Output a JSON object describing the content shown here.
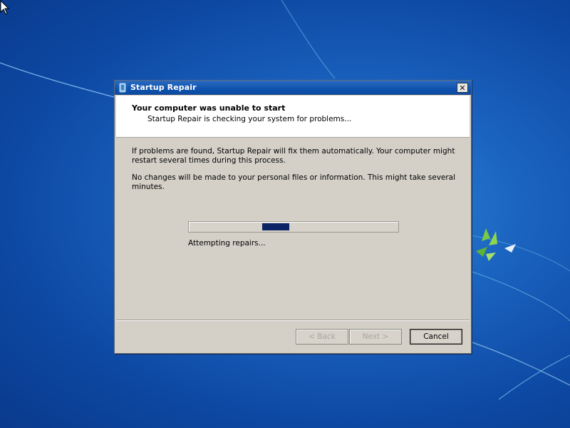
{
  "dialog": {
    "title": "Startup Repair",
    "header_title": "Your computer was unable to start",
    "header_subtitle": "Startup Repair is checking your system for problems...",
    "paragraph1": "If problems are found, Startup Repair will fix them automatically. Your computer might restart several times during this process.",
    "paragraph2": "No changes will be made to your personal files or information. This might take several minutes.",
    "status_text": "Attempting repairs...",
    "progress": {
      "start": 0.35,
      "end": 0.48
    },
    "close_label": "✕",
    "buttons": {
      "back": "< Back",
      "next": "Next >",
      "cancel": "Cancel"
    }
  },
  "colors": {
    "titlebar": "#0f53ae",
    "dialog_bg": "#d4d0c8",
    "progress_fill": "#0c2466",
    "desktop": "#1a63bf"
  },
  "icons": [
    "startup-repair-icon",
    "close-icon",
    "mouse-cursor-icon",
    "windows-logo-graphic"
  ]
}
